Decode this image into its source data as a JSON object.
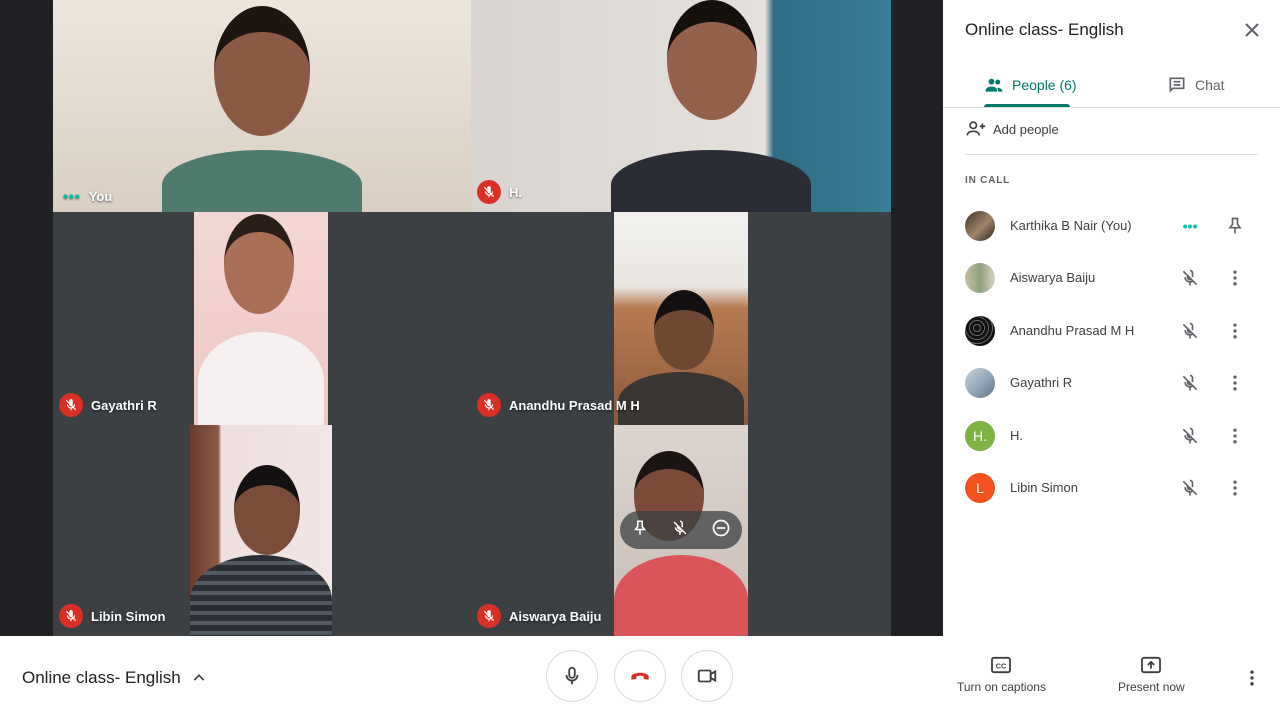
{
  "tiles": {
    "you": {
      "name": "You"
    },
    "h": {
      "name": "H."
    },
    "gayathri": {
      "name": "Gayathri R"
    },
    "anandhu": {
      "name": "Anandhu Prasad M H"
    },
    "libin": {
      "name": "Libin Simon"
    },
    "aiswarya": {
      "name": "Aiswarya Baiju"
    }
  },
  "panel": {
    "title": "Online class- English",
    "tabs": {
      "people": "People (6)",
      "chat": "Chat"
    },
    "add_people": "Add people",
    "section": "IN CALL",
    "people": [
      {
        "name": "Karthika B Nair (You)"
      },
      {
        "name": "Aiswarya Baiju"
      },
      {
        "name": "Anandhu Prasad M H"
      },
      {
        "name": "Gayathri R"
      },
      {
        "name": "H.",
        "initial": "H."
      },
      {
        "name": "Libin Simon",
        "initial": "L"
      }
    ]
  },
  "bottom": {
    "meeting_title": "Online class- English",
    "captions": "Turn on captions",
    "present": "Present now"
  },
  "colors": {
    "accent": "#00796b",
    "mute": "#d93025",
    "h_avatar": "#7cb342",
    "l_avatar": "#f4511e"
  }
}
